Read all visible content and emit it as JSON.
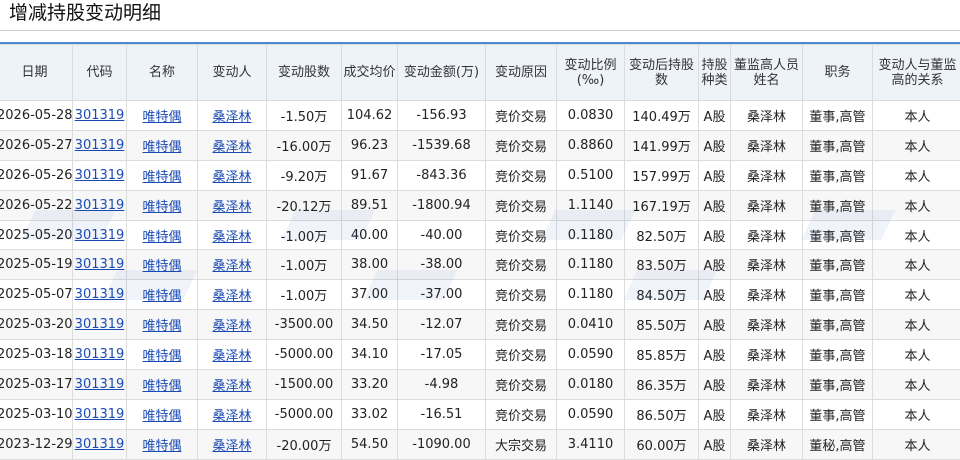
{
  "page": {
    "title": "增减持股变动明细"
  },
  "table": {
    "headers": [
      "日期",
      "代码",
      "名称",
      "变动人",
      "变动股数",
      "成交均价",
      "变动金额(万)",
      "变动原因",
      "变动比例(‰)",
      "变动后持股数",
      "持股种类",
      "董监高人员姓名",
      "职务",
      "变动人与董监高的关系"
    ],
    "rows": [
      [
        "2026-05-28",
        "301319",
        "唯特偶",
        "桑泽林",
        "-1.50万",
        "104.62",
        "-156.93",
        "竞价交易",
        "0.0830",
        "140.49万",
        "A股",
        "桑泽林",
        "董事,高管",
        "本人"
      ],
      [
        "2026-05-27",
        "301319",
        "唯特偶",
        "桑泽林",
        "-16.00万",
        "96.23",
        "-1539.68",
        "竞价交易",
        "0.8860",
        "141.99万",
        "A股",
        "桑泽林",
        "董事,高管",
        "本人"
      ],
      [
        "2026-05-26",
        "301319",
        "唯特偶",
        "桑泽林",
        "-9.20万",
        "91.67",
        "-843.36",
        "竞价交易",
        "0.5100",
        "157.99万",
        "A股",
        "桑泽林",
        "董事,高管",
        "本人"
      ],
      [
        "2026-05-22",
        "301319",
        "唯特偶",
        "桑泽林",
        "-20.12万",
        "89.51",
        "-1800.94",
        "竞价交易",
        "1.1140",
        "167.19万",
        "A股",
        "桑泽林",
        "董事,高管",
        "本人"
      ],
      [
        "2025-05-20",
        "301319",
        "唯特偶",
        "桑泽林",
        "-1.00万",
        "40.00",
        "-40.00",
        "竞价交易",
        "0.1180",
        "82.50万",
        "A股",
        "桑泽林",
        "董事,高管",
        "本人"
      ],
      [
        "2025-05-19",
        "301319",
        "唯特偶",
        "桑泽林",
        "-1.00万",
        "38.00",
        "-38.00",
        "竞价交易",
        "0.1180",
        "83.50万",
        "A股",
        "桑泽林",
        "董事,高管",
        "本人"
      ],
      [
        "2025-05-07",
        "301319",
        "唯特偶",
        "桑泽林",
        "-1.00万",
        "37.00",
        "-37.00",
        "竞价交易",
        "0.1180",
        "84.50万",
        "A股",
        "桑泽林",
        "董事,高管",
        "本人"
      ],
      [
        "2025-03-20",
        "301319",
        "唯特偶",
        "桑泽林",
        "-3500.00",
        "34.50",
        "-12.07",
        "竞价交易",
        "0.0410",
        "85.50万",
        "A股",
        "桑泽林",
        "董事,高管",
        "本人"
      ],
      [
        "2025-03-18",
        "301319",
        "唯特偶",
        "桑泽林",
        "-5000.00",
        "34.10",
        "-17.05",
        "竞价交易",
        "0.0590",
        "85.85万",
        "A股",
        "桑泽林",
        "董事,高管",
        "本人"
      ],
      [
        "2025-03-17",
        "301319",
        "唯特偶",
        "桑泽林",
        "-1500.00",
        "33.20",
        "-4.98",
        "竞价交易",
        "0.0180",
        "86.35万",
        "A股",
        "桑泽林",
        "董事,高管",
        "本人"
      ],
      [
        "2025-03-10",
        "301319",
        "唯特偶",
        "桑泽林",
        "-5000.00",
        "33.02",
        "-16.51",
        "竞价交易",
        "0.0590",
        "86.50万",
        "A股",
        "桑泽林",
        "董事,高管",
        "本人"
      ],
      [
        "2023-12-29",
        "301319",
        "唯特偶",
        "桑泽林",
        "-20.00万",
        "54.50",
        "-1090.00",
        "大宗交易",
        "3.4110",
        "60.00万",
        "A股",
        "桑泽林",
        "董秘,高管",
        "本人"
      ]
    ],
    "link_columns": [
      1,
      2,
      3
    ],
    "colors": {
      "link": "#1a4bb5",
      "header_bg": "#eef3fa",
      "accent_rule": "#4a8ad0"
    }
  }
}
